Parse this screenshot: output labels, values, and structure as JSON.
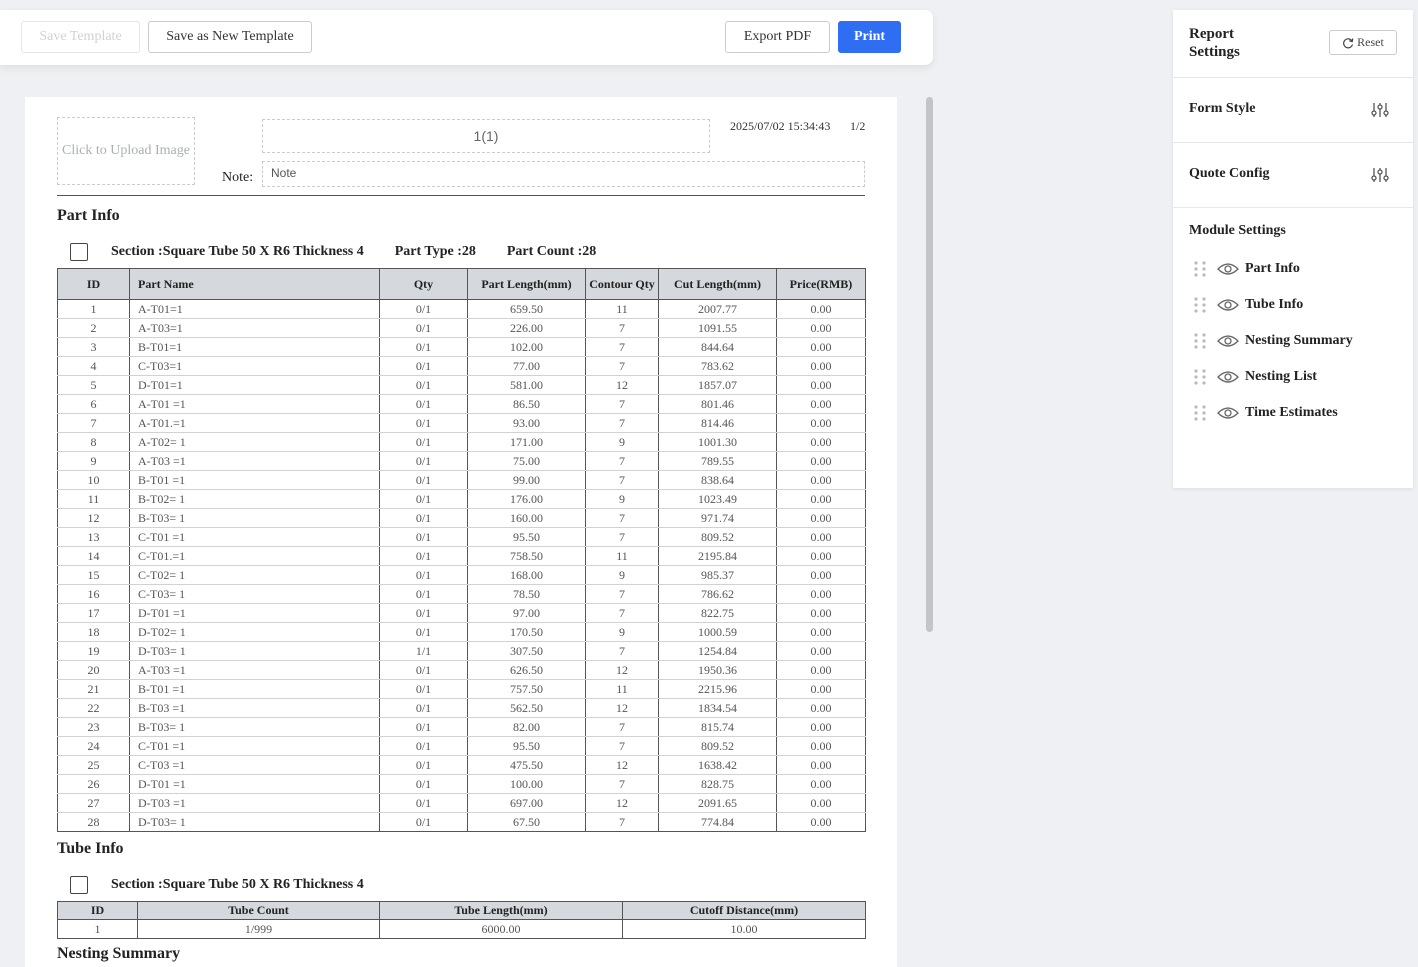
{
  "toolbar": {
    "save_template": "Save Template",
    "save_as_new": "Save as New Template",
    "export_pdf": "Export PDF",
    "print": "Print"
  },
  "report": {
    "upload_placeholder": "Click to Upload Image",
    "title_value": "1(1)",
    "datetime": "2025/07/02 15:34:43",
    "page": "1/2",
    "note_label": "Note:",
    "note_value": "Note"
  },
  "part_info": {
    "title": "Part Info",
    "section": "Section :Square Tube 50 X R6 Thickness 4",
    "part_type": "Part Type :28",
    "part_count": "Part Count :28",
    "columns": [
      "ID",
      "Part Name",
      "Qty",
      "Part Length(mm)",
      "Contour Qty",
      "Cut Length(mm)",
      "Price(RMB)"
    ],
    "rows": [
      [
        "1",
        "A-T01=1",
        "0/1",
        "659.50",
        "11",
        "2007.77",
        "0.00"
      ],
      [
        "2",
        "A-T03=1",
        "0/1",
        "226.00",
        "7",
        "1091.55",
        "0.00"
      ],
      [
        "3",
        "B-T01=1",
        "0/1",
        "102.00",
        "7",
        "844.64",
        "0.00"
      ],
      [
        "4",
        "C-T03=1",
        "0/1",
        "77.00",
        "7",
        "783.62",
        "0.00"
      ],
      [
        "5",
        "D-T01=1",
        "0/1",
        "581.00",
        "12",
        "1857.07",
        "0.00"
      ],
      [
        "6",
        "A-T01 =1",
        "0/1",
        "86.50",
        "7",
        "801.46",
        "0.00"
      ],
      [
        "7",
        "A-T01.=1",
        "0/1",
        "93.00",
        "7",
        "814.46",
        "0.00"
      ],
      [
        "8",
        "A-T02= 1",
        "0/1",
        "171.00",
        "9",
        "1001.30",
        "0.00"
      ],
      [
        "9",
        "A-T03 =1",
        "0/1",
        "75.00",
        "7",
        "789.55",
        "0.00"
      ],
      [
        "10",
        "B-T01 =1",
        "0/1",
        "99.00",
        "7",
        "838.64",
        "0.00"
      ],
      [
        "11",
        "B-T02= 1",
        "0/1",
        "176.00",
        "9",
        "1023.49",
        "0.00"
      ],
      [
        "12",
        "B-T03= 1",
        "0/1",
        "160.00",
        "7",
        "971.74",
        "0.00"
      ],
      [
        "13",
        "C-T01 =1",
        "0/1",
        "95.50",
        "7",
        "809.52",
        "0.00"
      ],
      [
        "14",
        "C-T01.=1",
        "0/1",
        "758.50",
        "11",
        "2195.84",
        "0.00"
      ],
      [
        "15",
        "C-T02= 1",
        "0/1",
        "168.00",
        "9",
        "985.37",
        "0.00"
      ],
      [
        "16",
        "C-T03= 1",
        "0/1",
        "78.50",
        "7",
        "786.62",
        "0.00"
      ],
      [
        "17",
        "D-T01 =1",
        "0/1",
        "97.00",
        "7",
        "822.75",
        "0.00"
      ],
      [
        "18",
        "D-T02= 1",
        "0/1",
        "170.50",
        "9",
        "1000.59",
        "0.00"
      ],
      [
        "19",
        "D-T03= 1",
        "1/1",
        "307.50",
        "7",
        "1254.84",
        "0.00"
      ],
      [
        "20",
        "A-T03 =1",
        "0/1",
        "626.50",
        "12",
        "1950.36",
        "0.00"
      ],
      [
        "21",
        "B-T01 =1",
        "0/1",
        "757.50",
        "11",
        "2215.96",
        "0.00"
      ],
      [
        "22",
        "B-T03 =1",
        "0/1",
        "562.50",
        "12",
        "1834.54",
        "0.00"
      ],
      [
        "23",
        "B-T03= 1",
        "0/1",
        "82.00",
        "7",
        "815.74",
        "0.00"
      ],
      [
        "24",
        "C-T01 =1",
        "0/1",
        "95.50",
        "7",
        "809.52",
        "0.00"
      ],
      [
        "25",
        "C-T03 =1",
        "0/1",
        "475.50",
        "12",
        "1638.42",
        "0.00"
      ],
      [
        "26",
        "D-T01 =1",
        "0/1",
        "100.00",
        "7",
        "828.75",
        "0.00"
      ],
      [
        "27",
        "D-T03 =1",
        "0/1",
        "697.00",
        "12",
        "2091.65",
        "0.00"
      ],
      [
        "28",
        "D-T03= 1",
        "0/1",
        "67.50",
        "7",
        "774.84",
        "0.00"
      ]
    ]
  },
  "tube_info": {
    "title": "Tube Info",
    "section": "Section :Square Tube 50 X R6 Thickness 4",
    "columns": [
      "ID",
      "Tube Count",
      "Tube Length(mm)",
      "Cutoff Distance(mm)"
    ],
    "rows": [
      [
        "1",
        "1/999",
        "6000.00",
        "10.00"
      ]
    ]
  },
  "nesting_summary": {
    "title": "Nesting Summary"
  },
  "settings": {
    "title": "Report Settings",
    "reset": "Reset",
    "form_style": "Form Style",
    "quote_config": "Quote Config",
    "module_settings": "Module Settings",
    "modules": [
      "Part Info",
      "Tube Info",
      "Nesting Summary",
      "Nesting List",
      "Time Estimates"
    ],
    "accent_color": "#2f6df3"
  }
}
